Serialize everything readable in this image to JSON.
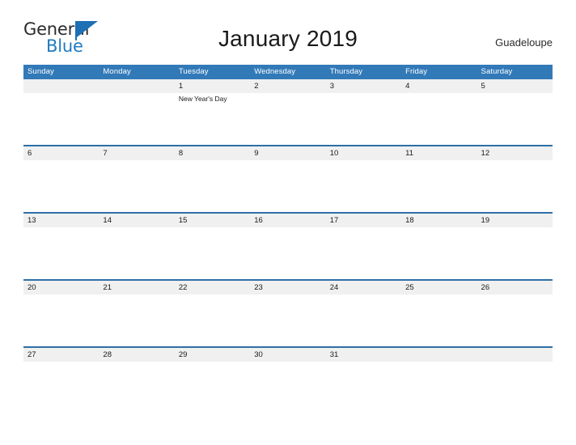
{
  "brand": {
    "name_line1": "General",
    "name_line2": "Blue",
    "flag_icon": "triangle-flag-icon",
    "color_dark": "#2b2b2b",
    "color_blue": "#1f7bc1"
  },
  "header": {
    "title": "January 2019",
    "location": "Guadeloupe"
  },
  "calendar": {
    "accent_header_bg": "#3279b8",
    "row_band_bg": "#f0f0f0",
    "row_rule_color": "#2f6fa8",
    "weekday_headers": [
      "Sunday",
      "Monday",
      "Tuesday",
      "Wednesday",
      "Thursday",
      "Friday",
      "Saturday"
    ],
    "weeks": [
      {
        "days": [
          {
            "num": "",
            "events": []
          },
          {
            "num": "",
            "events": []
          },
          {
            "num": "1",
            "events": [
              "New Year's Day"
            ]
          },
          {
            "num": "2",
            "events": []
          },
          {
            "num": "3",
            "events": []
          },
          {
            "num": "4",
            "events": []
          },
          {
            "num": "5",
            "events": []
          }
        ]
      },
      {
        "days": [
          {
            "num": "6",
            "events": []
          },
          {
            "num": "7",
            "events": []
          },
          {
            "num": "8",
            "events": []
          },
          {
            "num": "9",
            "events": []
          },
          {
            "num": "10",
            "events": []
          },
          {
            "num": "11",
            "events": []
          },
          {
            "num": "12",
            "events": []
          }
        ]
      },
      {
        "days": [
          {
            "num": "13",
            "events": []
          },
          {
            "num": "14",
            "events": []
          },
          {
            "num": "15",
            "events": []
          },
          {
            "num": "16",
            "events": []
          },
          {
            "num": "17",
            "events": []
          },
          {
            "num": "18",
            "events": []
          },
          {
            "num": "19",
            "events": []
          }
        ]
      },
      {
        "days": [
          {
            "num": "20",
            "events": []
          },
          {
            "num": "21",
            "events": []
          },
          {
            "num": "22",
            "events": []
          },
          {
            "num": "23",
            "events": []
          },
          {
            "num": "24",
            "events": []
          },
          {
            "num": "25",
            "events": []
          },
          {
            "num": "26",
            "events": []
          }
        ]
      },
      {
        "days": [
          {
            "num": "27",
            "events": []
          },
          {
            "num": "28",
            "events": []
          },
          {
            "num": "29",
            "events": []
          },
          {
            "num": "30",
            "events": []
          },
          {
            "num": "31",
            "events": []
          },
          {
            "num": "",
            "events": []
          },
          {
            "num": "",
            "events": []
          }
        ]
      }
    ]
  }
}
